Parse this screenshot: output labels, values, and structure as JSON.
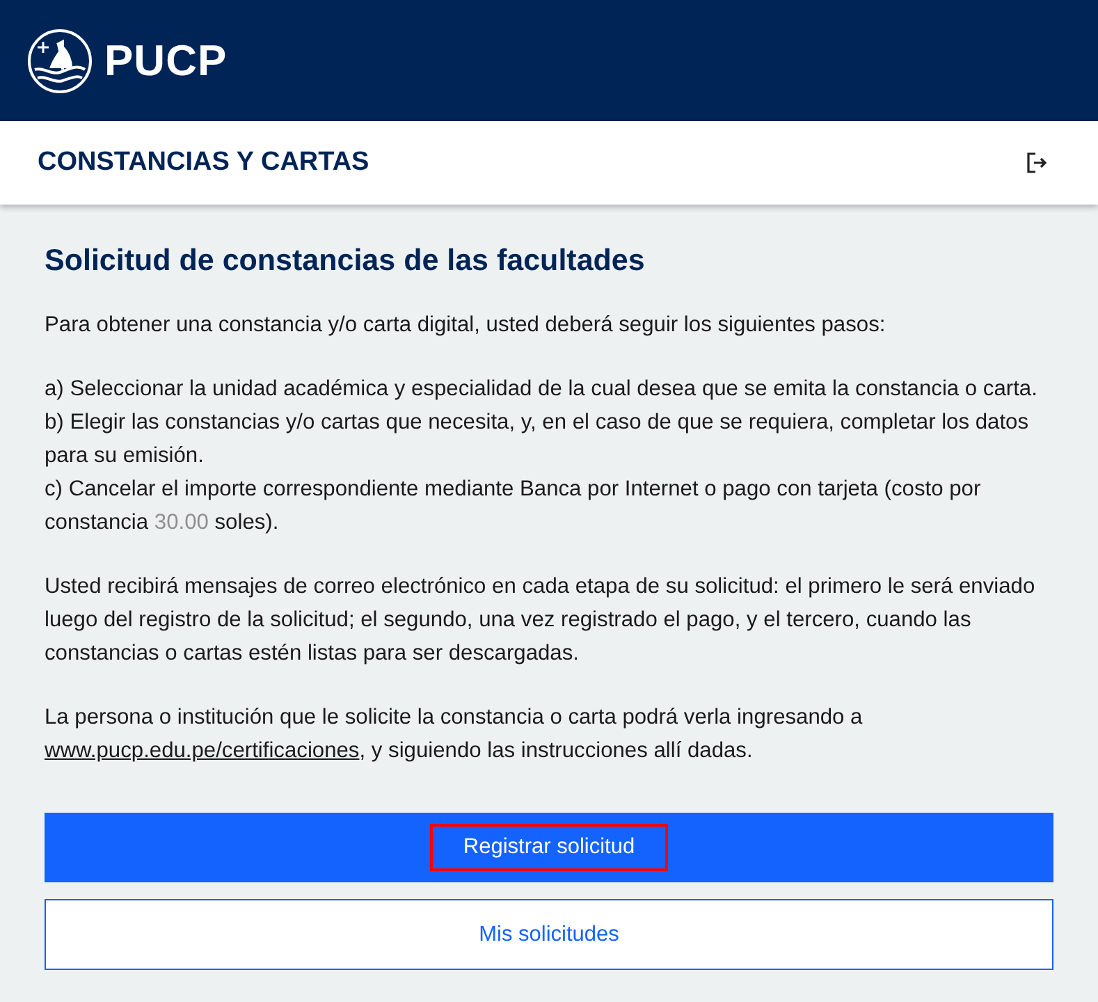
{
  "header": {
    "brand": "PUCP"
  },
  "subheader": {
    "title": "CONSTANCIAS Y CARTAS"
  },
  "content": {
    "heading": "Solicitud de constancias de las facultades",
    "intro": "Para obtener una constancia y/o carta digital, usted deberá seguir los siguientes pasos:",
    "steps": [
      {
        "text": "a) Seleccionar la unidad académica y especialidad de la cual desea que se emita la constancia o carta."
      },
      {
        "text": "b) Elegir las constancias y/o cartas que necesita, y, en el caso de que se requiera, completar los datos para su emisión."
      },
      {
        "text": "c) Cancelar el importe correspondiente mediante Banca por Internet o pago con tarjeta (costo por constancia ",
        "amount": "30.00",
        "after": " soles)."
      }
    ],
    "notice": "Usted recibirá mensajes de correo electrónico en cada etapa de su solicitud: el primero le será enviado luego del registro de la solicitud; el segundo, una vez registrado el pago, y el tercero, cuando las constancias o cartas estén listas para ser descargadas.",
    "verify_text": "La persona o institución que le solicite la constancia o carta podrá verla ingresando a ",
    "verify_link": "www.pucp.edu.pe/certificaciones",
    "verify_after": ", y siguiendo las instrucciones allí dadas.",
    "buttons": [
      {
        "label": "Registrar solicitud",
        "kind": "primary",
        "focused": true
      },
      {
        "label": "Mis solicitudes",
        "kind": "secondary",
        "focused": false
      }
    ]
  }
}
